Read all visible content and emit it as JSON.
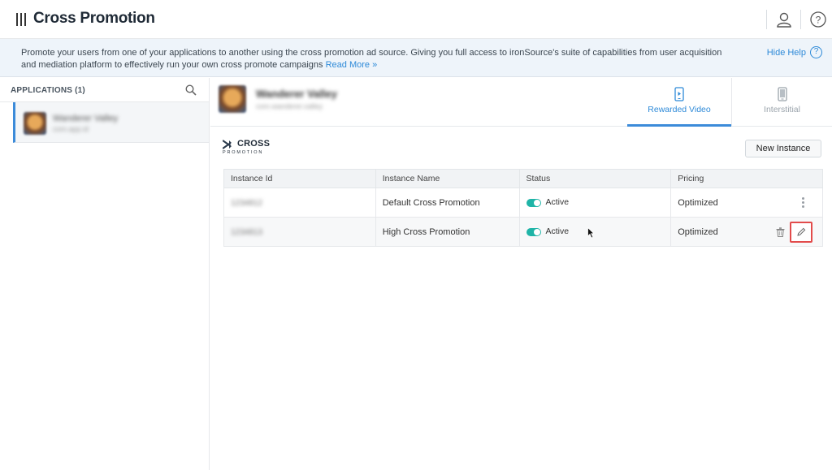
{
  "app": {
    "title": "Cross Promotion"
  },
  "header": {
    "user_icon": "user-icon",
    "help_icon": "help-circle-icon"
  },
  "help_banner": {
    "text": "Promote your users from one of your applications to another using the cross promotion ad source. Giving you full access to ironSource's suite of capabilities from user acquisition and mediation platform to effectively run your own cross promote campaigns",
    "link": "Read More »",
    "hide_label": "Hide Help"
  },
  "sidebar": {
    "title": "APPLICATIONS (1)",
    "search_icon": "search-icon",
    "selected_app": {
      "name": "Wanderer Valley",
      "sub": "com.app.id"
    }
  },
  "app_header": {
    "name": "Wanderer Valley",
    "sub": "com.wanderer.valley"
  },
  "tabs": [
    {
      "label": "Rewarded Video",
      "icon": "video-phone-icon",
      "active": true
    },
    {
      "label": "Interstitial",
      "icon": "phone-icon",
      "active": false
    }
  ],
  "brand": {
    "line1": "CROSS",
    "line2": "PROMOTION"
  },
  "new_instance_label": "New Instance",
  "table": {
    "columns": [
      "Instance Id",
      "Instance Name",
      "Status",
      "Pricing"
    ],
    "rows": [
      {
        "id": "1234812",
        "name": "Default Cross Promotion",
        "status": "Active",
        "pricing": "Optimized"
      },
      {
        "id": "1234813",
        "name": "High Cross Promotion",
        "status": "Active",
        "pricing": "Optimized"
      }
    ]
  },
  "colors": {
    "accent": "#2e8ad8",
    "toggle": "#1fb4a7",
    "highlight": "#e24b4b"
  }
}
